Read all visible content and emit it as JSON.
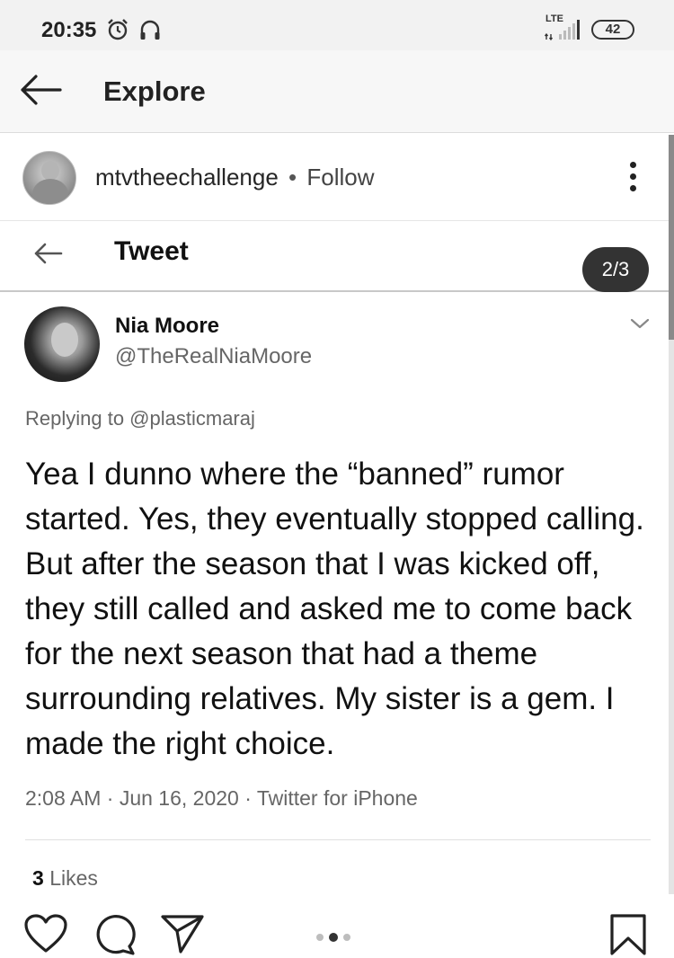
{
  "status_bar": {
    "time": "20:35",
    "network": "LTE",
    "battery": "42",
    "icons": [
      "alarm-icon",
      "headset-icon",
      "signal-icon",
      "battery-icon"
    ]
  },
  "app_bar": {
    "title": "Explore",
    "back_icon": "back-arrow-icon"
  },
  "post": {
    "account": "mtvtheechallenge",
    "separator": "•",
    "follow_label": "Follow",
    "more_icon": "more-vertical-icon"
  },
  "tweet": {
    "header_title": "Tweet",
    "page_indicator": "2/3",
    "author_name": "Nia Moore",
    "author_handle": "@TheRealNiaMoore",
    "replying_to": "Replying to @plasticmaraj",
    "text": "Yea I dunno where the “banned” rumor started. Yes, they eventually stopped calling. But after the season that I was kicked off, they still called and asked me to come back for the next season that had a theme surrounding relatives. My sister is a gem. I made the right choice.",
    "meta": "2:08 AM · Jun 16, 2020 · Twitter for iPhone",
    "likes_count": "3",
    "likes_label": "Likes"
  },
  "actions": {
    "icons": [
      "heart-icon",
      "comment-icon",
      "share-icon",
      "bookmark-icon"
    ],
    "carousel": {
      "total": 3,
      "active_index": 1
    }
  },
  "colors": {
    "background": "#ffffff",
    "status_bar": "#f2f2f2",
    "pill": "#333333",
    "secondary_text": "#666666"
  }
}
